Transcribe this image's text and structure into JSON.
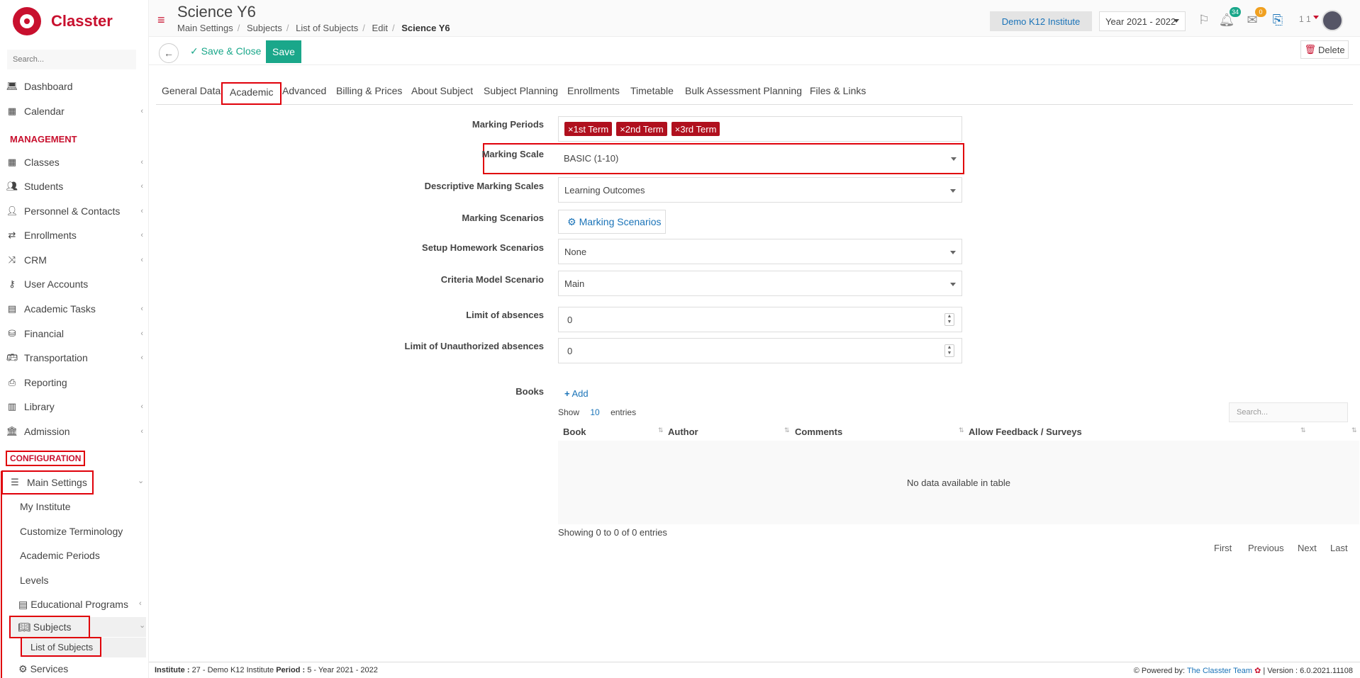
{
  "app": {
    "name": "Classter"
  },
  "sidebar": {
    "search_placeholder": "Search...",
    "top_items": [
      {
        "label": "Dashboard",
        "icon": "laptop-icon"
      },
      {
        "label": "Calendar",
        "icon": "calendar-icon"
      }
    ],
    "management_label": "MANAGEMENT",
    "management_items": [
      {
        "label": "Classes",
        "icon": "grid-icon"
      },
      {
        "label": "Students",
        "icon": "users-icon"
      },
      {
        "label": "Personnel & Contacts",
        "icon": "person-icon"
      },
      {
        "label": "Enrollments",
        "icon": "exchange-icon"
      },
      {
        "label": "CRM",
        "icon": "shuffle-icon"
      },
      {
        "label": "User Accounts",
        "icon": "key-icon"
      },
      {
        "label": "Academic Tasks",
        "icon": "tasks-icon"
      },
      {
        "label": "Financial",
        "icon": "coins-icon"
      },
      {
        "label": "Transportation",
        "icon": "bus-icon"
      },
      {
        "label": "Reporting",
        "icon": "printer-icon"
      },
      {
        "label": "Library",
        "icon": "library-icon"
      },
      {
        "label": "Admission",
        "icon": "bank-icon"
      }
    ],
    "configuration_label": "CONFIGURATION",
    "main_settings": "Main Settings",
    "sub_items": [
      "My Institute",
      "Customize Terminology",
      "Academic Periods",
      "Levels",
      "Educational Programs",
      "Subjects",
      "List of Subjects",
      "Services"
    ]
  },
  "header": {
    "title": "Science Y6",
    "breadcrumb": [
      "Main Settings",
      "Subjects",
      "List of Subjects",
      "Edit",
      "Science Y6"
    ],
    "institute": "Demo K12 Institute",
    "year": "Year 2021 - 2022",
    "notifications": "34",
    "messages": "0",
    "user_num": "1 1"
  },
  "toolbar": {
    "save_close": "Save & Close",
    "save": "Save",
    "delete": "Delete"
  },
  "tabs": [
    "General Data",
    "Academic",
    "Advanced",
    "Billing & Prices",
    "About Subject",
    "Subject Planning",
    "Enrollments",
    "Timetable",
    "Bulk Assessment Planning",
    "Files & Links"
  ],
  "form": {
    "marking_periods_label": "Marking Periods",
    "marking_periods": [
      "×1st Term",
      "×2nd Term",
      "×3rd Term"
    ],
    "marking_scale_label": "Marking Scale",
    "marking_scale": "BASIC (1-10)",
    "descriptive_label": "Descriptive Marking Scales",
    "descriptive": "Learning Outcomes",
    "scenarios_label": "Marking Scenarios",
    "scenarios_button": "Marking Scenarios",
    "homework_label": "Setup Homework Scenarios",
    "homework": "None",
    "criteria_label": "Criteria Model Scenario",
    "criteria": "Main",
    "absences_label": "Limit of absences",
    "absences": "0",
    "unauth_label": "Limit of Unauthorized absences",
    "unauth": "0"
  },
  "books": {
    "label": "Books",
    "add": "Add",
    "show": "Show",
    "entries_num": "10",
    "entries": "entries",
    "search_placeholder": "Search...",
    "columns": [
      "Book",
      "Author",
      "Comments",
      "Allow Feedback / Surveys"
    ],
    "empty": "No data available in table",
    "showing": "Showing 0 to 0 of 0 entries",
    "pager": [
      "First",
      "Previous",
      "Next",
      "Last"
    ]
  },
  "footer": {
    "institute_label": "Institute :",
    "institute": "27 - Demo K12 Institute",
    "period_label": "Period :",
    "period": "5 - Year 2021 - 2022",
    "powered": "Powered by:",
    "team": "The Classter Team",
    "version": "| Version : 6.0.2021.11108"
  }
}
